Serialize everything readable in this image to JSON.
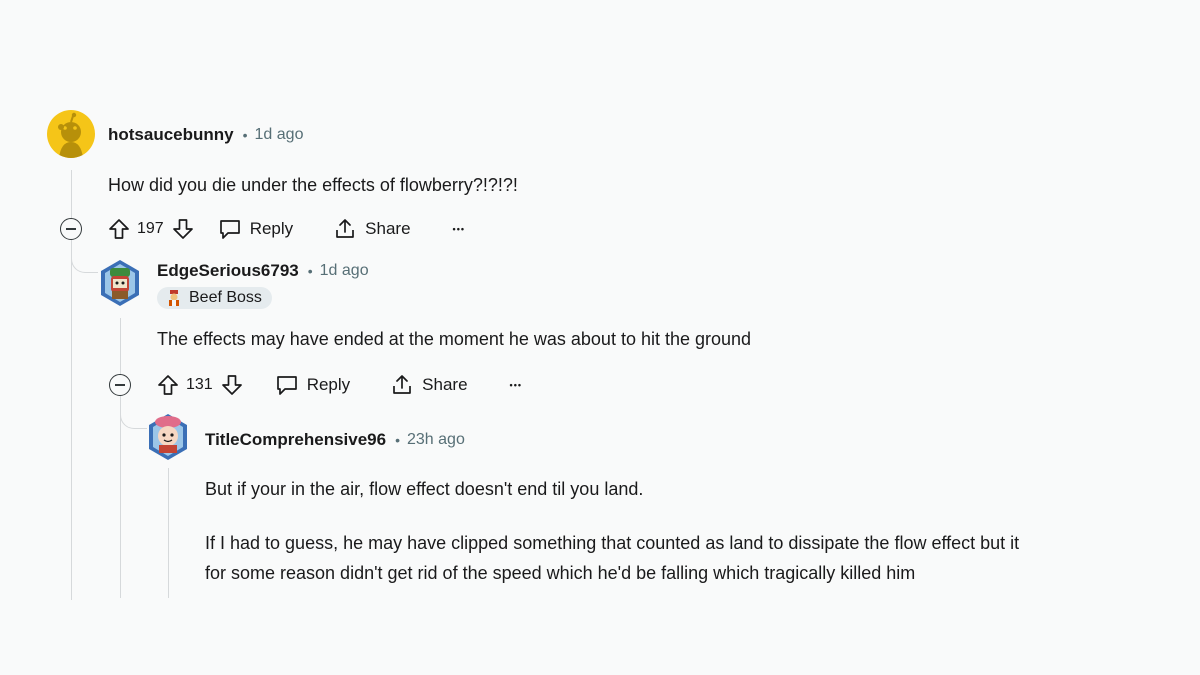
{
  "comments": [
    {
      "username": "hotsaucebunny",
      "separator": "•",
      "time": "1d ago",
      "body": [
        "How did you die under the effects of flowberry?!?!?!"
      ],
      "votes": "197",
      "reply_label": "Reply",
      "share_label": "Share",
      "more_label": "•••"
    },
    {
      "username": "EdgeSerious6793",
      "separator": "•",
      "time": "1d ago",
      "flair": "Beef Boss",
      "body": [
        "The effects may have ended at the moment he was about to hit the ground"
      ],
      "votes": "131",
      "reply_label": "Reply",
      "share_label": "Share",
      "more_label": "•••"
    },
    {
      "username": "TitleComprehensive96",
      "separator": "•",
      "time": "23h ago",
      "body": [
        "But if your in the air, flow effect doesn't end til you land.",
        "If I had to guess, he may have clipped something that counted as land to dissipate the flow effect but it",
        "for some reason didn't get rid of the speed which he'd be falling which tragically killed him"
      ]
    }
  ],
  "colors": {
    "background": "#f9fafa",
    "meta_text": "#576f76",
    "thread_line": "#d6d9db",
    "avatar_yellow": "#f5c518",
    "flair_bg": "#e5ebee"
  },
  "icons": [
    "collapse-icon",
    "upvote-icon",
    "downvote-icon",
    "reply-icon",
    "share-icon",
    "more-icon"
  ]
}
